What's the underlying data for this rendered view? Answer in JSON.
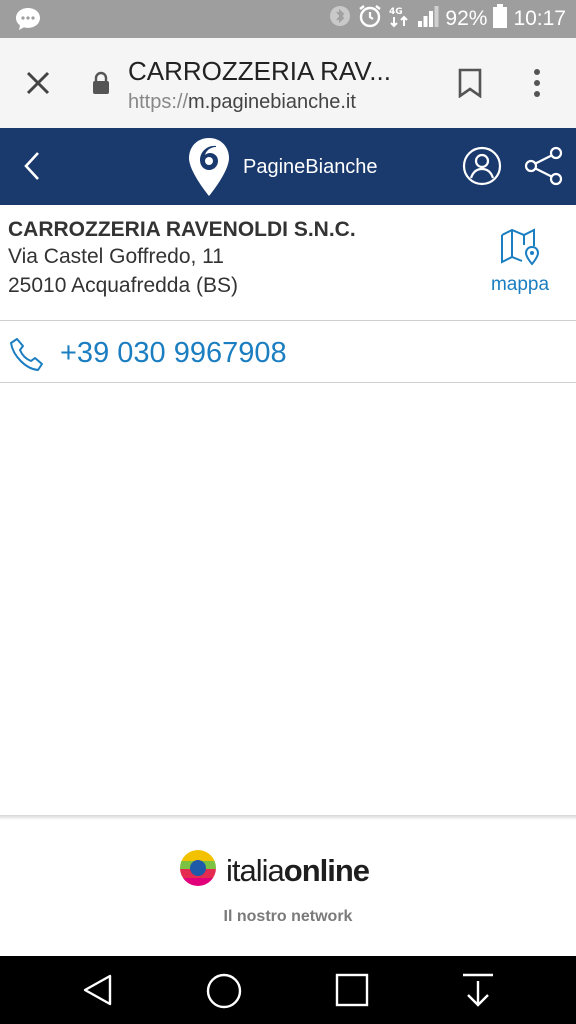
{
  "status_bar": {
    "battery": "92%",
    "time": "10:17",
    "icons": [
      "chat-bubble-icon",
      "bluetooth-icon",
      "alarm-icon",
      "data-transfer-icon",
      "signal-icon",
      "battery-icon"
    ]
  },
  "browser": {
    "page_title": "CARROZZERIA RAV...",
    "url_scheme": "https://",
    "url_host": "m.paginebianche.it",
    "icons": [
      "close-icon",
      "lock-icon",
      "bookmark-icon",
      "overflow-menu-icon"
    ]
  },
  "app_header": {
    "brand_first": "Pagine",
    "brand_second": "Bianche",
    "background_color": "#1a3a6e",
    "icons": [
      "back-chevron-icon",
      "paginebianche-pin-logo",
      "user-account-icon",
      "share-icon"
    ]
  },
  "business": {
    "name": "CARROZZERIA RAVENOLDI S.N.C.",
    "address_line1": "Via Castel Goffredo, 11",
    "address_line2": "25010 Acquafredda (BS)",
    "map_label": "mappa",
    "map_icon": "map-pin-icon"
  },
  "contact": {
    "phone": "+39 030 9967908",
    "phone_icon": "phone-handset-icon",
    "link_color": "#1b7ec1"
  },
  "footer": {
    "brand_light": "italia",
    "brand_bold": "online",
    "tagline": "Il nostro network"
  },
  "nav_bar": {
    "icons": [
      "nav-back-icon",
      "nav-home-icon",
      "nav-recents-icon",
      "nav-notifications-down-icon"
    ]
  }
}
